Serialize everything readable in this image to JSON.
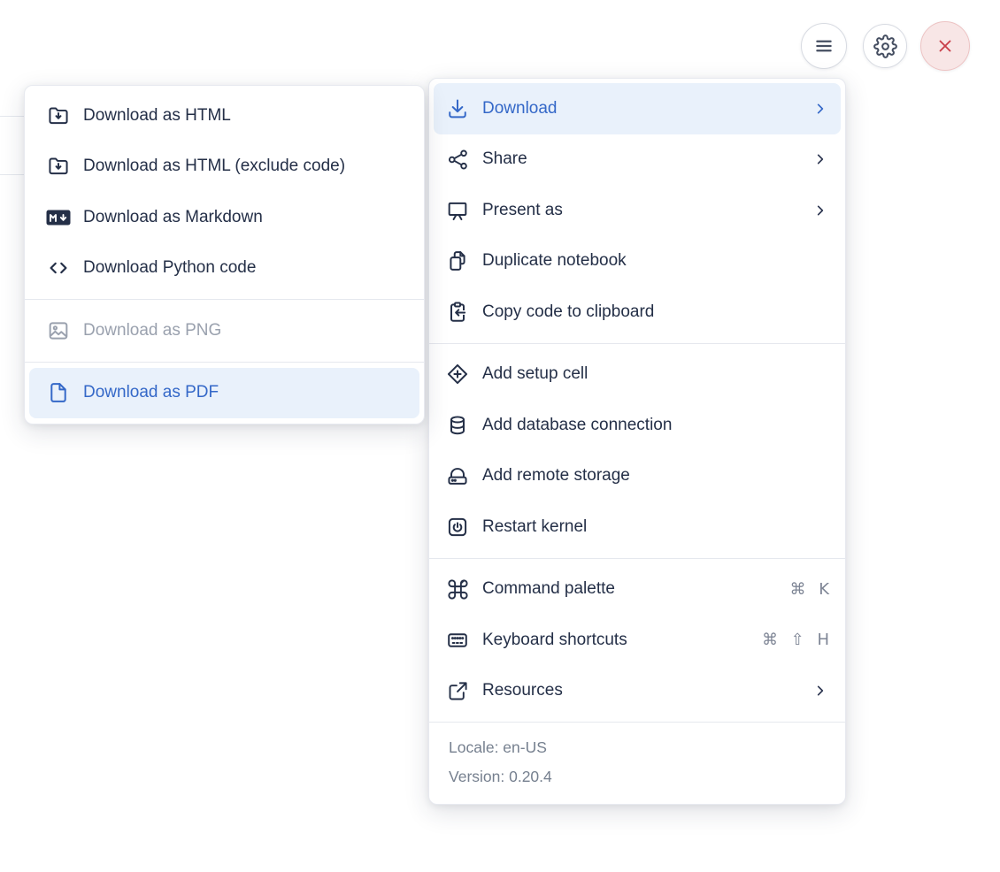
{
  "toolbar": {
    "buttons": [
      {
        "name": "menu",
        "icon": "hamburger-icon"
      },
      {
        "name": "settings",
        "icon": "gear-icon"
      },
      {
        "name": "close",
        "icon": "close-icon"
      }
    ]
  },
  "menu": {
    "sections": [
      {
        "items": [
          {
            "label": "Download",
            "icon": "download-icon",
            "has_submenu": true,
            "active": true
          },
          {
            "label": "Share",
            "icon": "share-icon",
            "has_submenu": true
          },
          {
            "label": "Present as",
            "icon": "presentation-icon",
            "has_submenu": true
          },
          {
            "label": "Duplicate notebook",
            "icon": "duplicate-icon"
          },
          {
            "label": "Copy code to clipboard",
            "icon": "clipboard-paste-icon"
          }
        ]
      },
      {
        "items": [
          {
            "label": "Add setup cell",
            "icon": "diamond-plus-icon"
          },
          {
            "label": "Add database connection",
            "icon": "database-icon"
          },
          {
            "label": "Add remote storage",
            "icon": "storage-drive-icon"
          },
          {
            "label": "Restart kernel",
            "icon": "power-icon"
          }
        ]
      },
      {
        "items": [
          {
            "label": "Command palette",
            "icon": "command-icon",
            "shortcut": "⌘ K"
          },
          {
            "label": "Keyboard shortcuts",
            "icon": "keyboard-icon",
            "shortcut": "⌘ ⇧ H"
          },
          {
            "label": "Resources",
            "icon": "external-link-icon",
            "has_submenu": true
          }
        ]
      }
    ],
    "footer": {
      "locale": "Locale: en-US",
      "version": "Version: 0.20.4"
    }
  },
  "submenu": {
    "sections": [
      {
        "items": [
          {
            "label": "Download as HTML",
            "icon": "folder-download-icon"
          },
          {
            "label": "Download as HTML (exclude code)",
            "icon": "folder-download-icon"
          },
          {
            "label": "Download as Markdown",
            "icon": "markdown-icon"
          },
          {
            "label": "Download Python code",
            "icon": "code-icon"
          }
        ]
      },
      {
        "items": [
          {
            "label": "Download as PNG",
            "icon": "image-icon",
            "disabled": true
          }
        ]
      },
      {
        "items": [
          {
            "label": "Download as PDF",
            "icon": "file-icon",
            "active": true
          }
        ]
      }
    ]
  },
  "colors": {
    "accent_blue": "#3468c8",
    "highlight_bg": "#e9f1fb",
    "text_dark": "#242f47",
    "disabled_gray": "#9aa1ae",
    "close_red": "#c9404a"
  }
}
